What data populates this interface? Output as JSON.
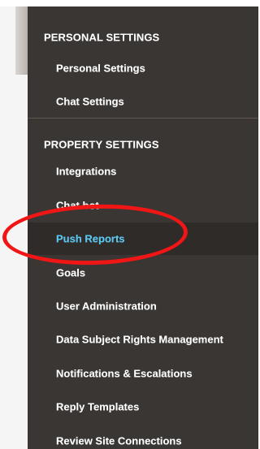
{
  "sidebar": {
    "personal_header": "PERSONAL SETTINGS",
    "personal_items": [
      {
        "label": "Personal Settings"
      },
      {
        "label": "Chat Settings"
      }
    ],
    "property_header": "PROPERTY SETTINGS",
    "property_items": [
      {
        "label": "Integrations"
      },
      {
        "label": "Chat bot"
      },
      {
        "label": "Push Reports"
      },
      {
        "label": "Goals"
      },
      {
        "label": "User Administration"
      },
      {
        "label": "Data Subject Rights Management"
      },
      {
        "label": "Notifications & Escalations"
      },
      {
        "label": "Reply Templates"
      },
      {
        "label": "Review Site Connections"
      }
    ],
    "active_item": "Push Reports"
  },
  "colors": {
    "panel_background": "#3a3634",
    "active_text": "#55c7f5",
    "annotation": "#f01616"
  }
}
